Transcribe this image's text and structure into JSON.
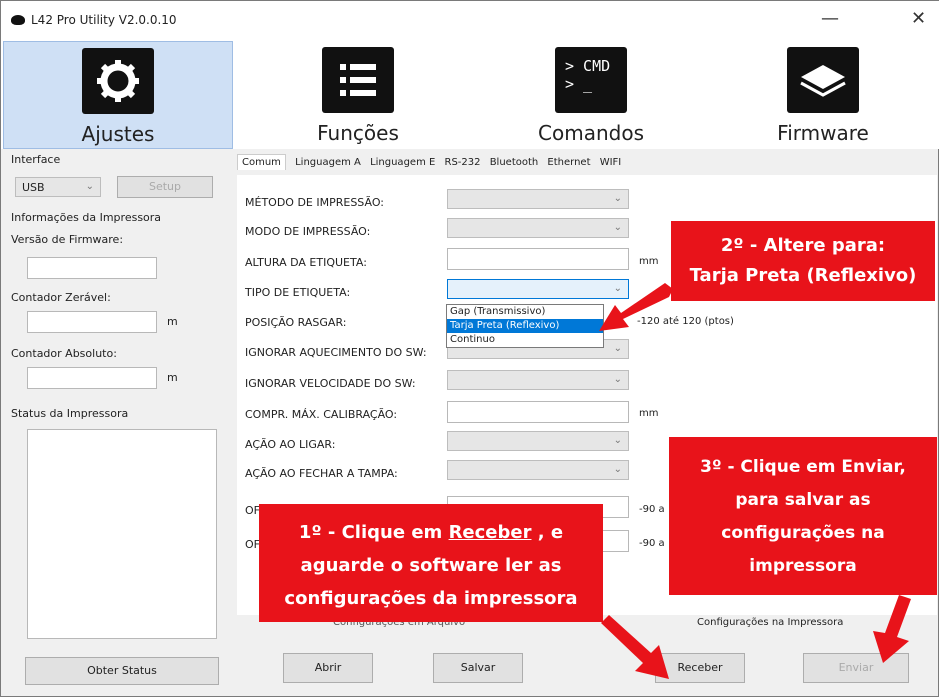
{
  "window": {
    "title": "L42 Pro Utility  V2.0.0.10",
    "minimize": "—",
    "close": "✕"
  },
  "toolbar": {
    "items": [
      {
        "label": "Ajustes",
        "icon": "gear-icon"
      },
      {
        "label": "Funções",
        "icon": "list-icon"
      },
      {
        "label": "Comandos",
        "icon": "cmd-icon",
        "icon_text": "> CMD\n> _"
      },
      {
        "label": "Firmware",
        "icon": "chip-icon"
      }
    ]
  },
  "left": {
    "interface_label": "Interface",
    "interface_value": "USB",
    "setup_button": "Setup",
    "printer_info": "Informações da Impressora",
    "firmware_version": "Versão de Firmware:",
    "reset_counter": "Contador Zerável:",
    "absolute_counter": "Contador Absoluto:",
    "unit_m": "m",
    "printer_status": "Status da Impressora",
    "get_status": "Obter Status"
  },
  "tabs": [
    "Comum",
    "Linguagem A",
    "Linguagem E",
    "RS-232",
    "Bluetooth",
    "Ethernet",
    "WIFI"
  ],
  "form": {
    "rows": [
      {
        "label": "MÉTODO DE IMPRESSÃO:",
        "type": "combo"
      },
      {
        "label": "MODO DE IMPRESSÃO:",
        "type": "combo"
      },
      {
        "label": "ALTURA DA ETIQUETA:",
        "type": "input",
        "unit": "mm"
      },
      {
        "label": "TIPO DE ETIQUETA:",
        "type": "combo-open"
      },
      {
        "label": "POSIÇÃO RASGAR:",
        "type": "input",
        "unit": "-120 até 120 (ptos)"
      },
      {
        "label": "IGNORAR AQUECIMENTO DO SW:",
        "type": "combo"
      },
      {
        "label": "IGNORAR VELOCIDADE DO SW:",
        "type": "combo"
      },
      {
        "label": "COMPR. MÁX. CALIBRAÇÃO:",
        "type": "input",
        "unit": "mm"
      },
      {
        "label": "AÇÃO AO LIGAR:",
        "type": "combo"
      },
      {
        "label": "AÇÃO AO FECHAR A TAMPA:",
        "type": "combo"
      },
      {
        "label": "OF",
        "type": "input",
        "unit": "-90 a"
      },
      {
        "label": "OF",
        "type": "input",
        "unit": "-90 a"
      }
    ],
    "dropdown_options": [
      "Gap (Transmissivo)",
      "Tarja Preta (Reflexivo)",
      "Continuo"
    ],
    "dropdown_selected": 1
  },
  "bottom": {
    "file_config": "Configurações em Arquivo",
    "open": "Abrir",
    "save": "Salvar",
    "printer_config": "Configurações na Impressora",
    "receive": "Receber",
    "send": "Enviar"
  },
  "callouts": {
    "step2_line1": "2º - Altere para:",
    "step2_line2": "Tarja Preta (Reflexivo)",
    "step3_line1": "3º - Clique em Enviar,",
    "step3_line2": "para salvar as",
    "step3_line3": "configurações na",
    "step3_line4": "impressora",
    "step1_line1_pre": "1º - Clique em ",
    "step1_line1_link": "Receber",
    "step1_line1_post": " , e",
    "step1_line2": "aguarde o software ler as",
    "step1_line3": "configurações da impressora"
  },
  "colors": {
    "accent_red": "#e8131a",
    "selection_blue": "#0078d7",
    "active_tab_bg": "#cfe0f5"
  }
}
